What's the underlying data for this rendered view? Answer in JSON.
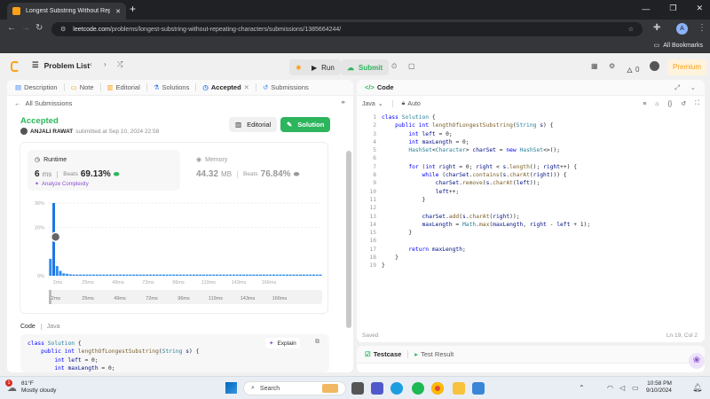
{
  "browser": {
    "tab_title": "Longest Substring Without Repe",
    "url_domain": "leetcode.com",
    "url_path": "/problems/longest-substring-without-repeating-characters/submissions/1385664244/",
    "bookmarks_label": "All Bookmarks",
    "avatar_letter": "A"
  },
  "nav": {
    "problem_list": "Problem List",
    "run": "Run",
    "submit": "Submit",
    "coins": "0",
    "premium": "Premium"
  },
  "left": {
    "tabs": [
      {
        "label": "Description"
      },
      {
        "label": "Note"
      },
      {
        "label": "Editorial"
      },
      {
        "label": "Solutions"
      },
      {
        "label": "Accepted"
      },
      {
        "label": "Submissions"
      }
    ],
    "back_label": "All Submissions",
    "status": "Accepted",
    "user": "ANJALI RAWAT",
    "submitted": "submitted at Sep 10, 2024 22:58",
    "editorial_btn": "Editorial",
    "solution_btn": "Solution",
    "runtime": {
      "label": "Runtime",
      "value": "6",
      "unit": "ms",
      "beats_label": "Beats",
      "beats": "69.13%",
      "analyze": "Analyze Complexity"
    },
    "memory": {
      "label": "Memory",
      "value": "44.32",
      "unit": "MB",
      "beats_label": "Beats",
      "beats": "76.84%"
    },
    "code_label": "Code",
    "lang_label": "Java",
    "explain": "Explain",
    "code_preview": [
      "class Solution {",
      "    public int lengthOfLongestSubstring(String s) {",
      "        int left = 0;",
      "        int maxLength = 0;"
    ]
  },
  "chart_data": {
    "type": "bar",
    "x": [
      "2ms",
      "25ms",
      "49ms",
      "72ms",
      "96ms",
      "119ms",
      "143ms",
      "166ms"
    ],
    "y_ticks": [
      "30%",
      "20%",
      "0%"
    ],
    "ylim": [
      0,
      30
    ],
    "values": [
      7,
      30,
      4,
      2,
      1,
      0.8,
      0.6,
      0.5,
      0.5,
      0.5,
      0.5,
      0.5,
      0.5,
      0.5,
      0.5,
      0.5,
      0.5,
      0.5,
      0.5,
      0.5,
      0.5,
      0.5,
      0.5,
      0.5,
      0.5,
      0.5,
      0.5,
      0.5,
      0.5,
      0.5,
      0.5,
      0.5,
      0.5,
      0.5,
      0.5,
      0.5,
      0.5,
      0.5,
      0.5,
      0.5,
      0.5,
      0.5,
      0.5,
      0.5,
      0.5,
      0.5,
      0.5,
      0.5,
      0.5,
      0.5,
      0.5,
      0.5,
      0.5,
      0.5,
      0.5,
      0.5,
      0.5,
      0.5,
      0.5,
      0.5,
      0.5,
      0.5,
      0.5,
      0.5,
      0.5,
      0.5,
      0.5,
      0.5,
      0.5,
      0.5,
      0.5,
      0.5,
      0.5,
      0.5,
      0.5,
      0.5,
      0.5,
      0.5,
      0.5,
      0.5,
      0.5,
      0.5
    ],
    "highlight_index": 1,
    "bar_color": "#2d8cf0",
    "highlight_color": "#1a73e8"
  },
  "right": {
    "code_tab": "Code",
    "lang": "Java",
    "auto": "Auto",
    "saved": "Saved",
    "cursor": "Ln 19, Col 2",
    "testcase": "Testcase",
    "test_result": "Test Result",
    "lines": [
      [
        [
          "kw",
          "class "
        ],
        [
          "ty",
          "Solution "
        ],
        [
          "",
          "{"
        ]
      ],
      [
        [
          "",
          "    "
        ],
        [
          "kw",
          "public int "
        ],
        [
          "fn",
          "lengthOfLongestSubstring"
        ],
        [
          "",
          "("
        ],
        [
          "ty",
          "String "
        ],
        [
          "vr",
          "s"
        ],
        [
          "",
          ") {"
        ]
      ],
      [
        [
          "",
          "        "
        ],
        [
          "kw",
          "int "
        ],
        [
          "vr",
          "left "
        ],
        [
          "",
          "= "
        ],
        [
          "",
          "0;"
        ]
      ],
      [
        [
          "",
          "        "
        ],
        [
          "kw",
          "int "
        ],
        [
          "vr",
          "maxLength "
        ],
        [
          "",
          "= 0;"
        ]
      ],
      [
        [
          "",
          "        "
        ],
        [
          "ty",
          "HashSet"
        ],
        [
          "",
          "<"
        ],
        [
          "ty",
          "Character"
        ],
        [
          "",
          "> "
        ],
        [
          "vr",
          "charSet "
        ],
        [
          "",
          "= "
        ],
        [
          "kw",
          "new "
        ],
        [
          "ty",
          "HashSet"
        ],
        [
          "",
          "<>();"
        ]
      ],
      [
        [
          "",
          ""
        ]
      ],
      [
        [
          "",
          "        "
        ],
        [
          "kw",
          "for "
        ],
        [
          "",
          "("
        ],
        [
          "kw",
          "int "
        ],
        [
          "vr",
          "right "
        ],
        [
          "",
          "= 0; "
        ],
        [
          "vr",
          "right "
        ],
        [
          "",
          "< "
        ],
        [
          "vr",
          "s"
        ],
        [
          "",
          "."
        ],
        [
          "fn",
          "length"
        ],
        [
          "",
          "(); "
        ],
        [
          "vr",
          "right"
        ],
        [
          "",
          "++) {"
        ]
      ],
      [
        [
          "",
          "            "
        ],
        [
          "kw",
          "while "
        ],
        [
          "",
          "("
        ],
        [
          "vr",
          "charSet"
        ],
        [
          "",
          "."
        ],
        [
          "fn",
          "contains"
        ],
        [
          "",
          "("
        ],
        [
          "vr",
          "s"
        ],
        [
          "",
          "."
        ],
        [
          "fn",
          "charAt"
        ],
        [
          "",
          "("
        ],
        [
          "vr",
          "right"
        ],
        [
          "",
          "))) {"
        ]
      ],
      [
        [
          "",
          "                "
        ],
        [
          "vr",
          "charSet"
        ],
        [
          "",
          "."
        ],
        [
          "fn",
          "remove"
        ],
        [
          "",
          "("
        ],
        [
          "vr",
          "s"
        ],
        [
          "",
          "."
        ],
        [
          "fn",
          "charAt"
        ],
        [
          "",
          "("
        ],
        [
          "vr",
          "left"
        ],
        [
          "",
          "));"
        ]
      ],
      [
        [
          "",
          "                "
        ],
        [
          "vr",
          "left"
        ],
        [
          "",
          "++;"
        ]
      ],
      [
        [
          "",
          "            }"
        ]
      ],
      [
        [
          "",
          ""
        ]
      ],
      [
        [
          "",
          "            "
        ],
        [
          "vr",
          "charSet"
        ],
        [
          "",
          "."
        ],
        [
          "fn",
          "add"
        ],
        [
          "",
          "("
        ],
        [
          "vr",
          "s"
        ],
        [
          "",
          "."
        ],
        [
          "fn",
          "charAt"
        ],
        [
          "",
          "("
        ],
        [
          "vr",
          "right"
        ],
        [
          "",
          "));"
        ]
      ],
      [
        [
          "",
          "            "
        ],
        [
          "vr",
          "maxLength "
        ],
        [
          "",
          "= "
        ],
        [
          "ty",
          "Math"
        ],
        [
          "",
          "."
        ],
        [
          "fn",
          "max"
        ],
        [
          "",
          "("
        ],
        [
          "vr",
          "maxLength"
        ],
        [
          "",
          ", "
        ],
        [
          "vr",
          "right "
        ],
        [
          "",
          "- "
        ],
        [
          "vr",
          "left "
        ],
        [
          "",
          "+ 1);"
        ]
      ],
      [
        [
          "",
          "        }"
        ]
      ],
      [
        [
          "",
          ""
        ]
      ],
      [
        [
          "",
          "        "
        ],
        [
          "kw",
          "return "
        ],
        [
          "vr",
          "maxLength"
        ],
        [
          "",
          ";"
        ]
      ],
      [
        [
          "",
          "    }"
        ]
      ],
      [
        [
          "",
          "}"
        ]
      ]
    ]
  },
  "taskbar": {
    "weather_temp": "81°F",
    "weather_desc": "Mostly cloudy",
    "search": "Search",
    "time": "10:58 PM",
    "date": "9/10/2024",
    "notif": "1"
  }
}
